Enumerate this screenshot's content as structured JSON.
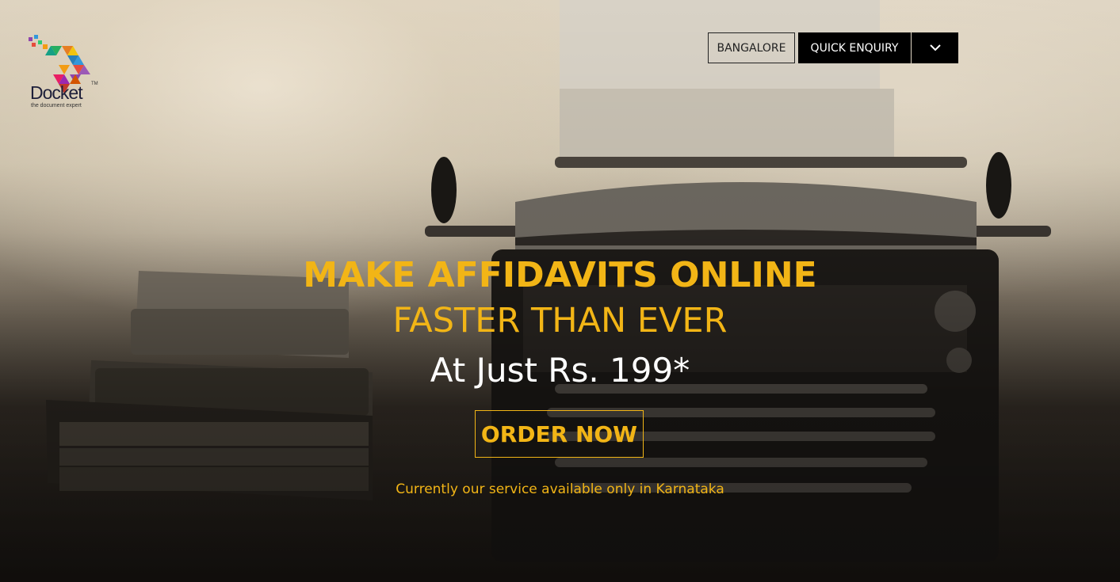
{
  "brand": {
    "name": "Docket",
    "trademark": "TM",
    "tagline": "the document expert"
  },
  "nav": {
    "city_label": "BANGALORE",
    "enquiry_label": "QUICK ENQUIRY",
    "toggle_icon": "chevron-down-icon"
  },
  "hero": {
    "headline": "MAKE AFFIDAVITS ONLINE",
    "subline": "FASTER THAN EVER",
    "price": "At Just Rs. 199*",
    "cta_label": "ORDER NOW",
    "note": "Currently our service available only in Karnataka"
  },
  "colors": {
    "accent": "#f2b516",
    "nav_dark": "#000000",
    "price_text": "#ffffff"
  }
}
